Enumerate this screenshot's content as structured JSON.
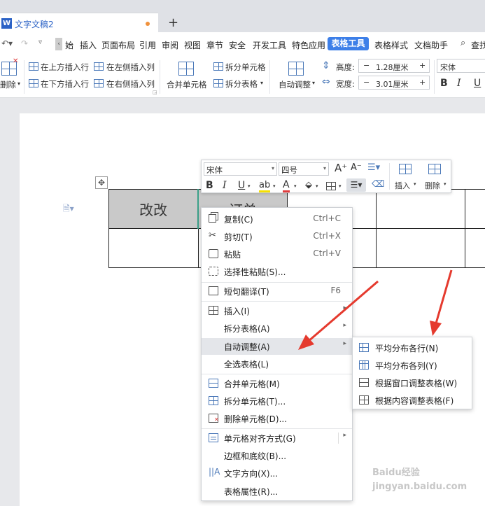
{
  "tab": {
    "title": "文字文稿2",
    "app_icon": "W",
    "new_tab": "+"
  },
  "menu": {
    "items": [
      "始",
      "插入",
      "页面布局",
      "引用",
      "审阅",
      "视图",
      "章节",
      "安全",
      "开发工具",
      "特色应用",
      "表格工具",
      "表格样式",
      "文档助手"
    ],
    "active": "表格工具",
    "search": "查找"
  },
  "ribbon": {
    "delete": "删除",
    "insert_above": "在上方插入行",
    "insert_below": "在下方插入行",
    "insert_left": "在左侧插入列",
    "insert_right": "在右侧插入列",
    "merge": "合并单元格",
    "split_cell": "拆分单元格",
    "split_table": "拆分表格",
    "auto_fit": "自动调整",
    "height_label": "高度:",
    "height_value": "1.28厘米",
    "width_label": "宽度:",
    "width_value": "3.01厘米",
    "font": "宋体",
    "minus": "−",
    "plus": "+"
  },
  "table": {
    "cell1": "改改",
    "cell2": "订单"
  },
  "mini_toolbar": {
    "font": "宋体",
    "size": "四号",
    "bold": "B",
    "italic": "I",
    "underline": "U",
    "font_color": "A",
    "grow": "A⁺",
    "shrink": "A⁻",
    "insert": "插入",
    "delete": "删除"
  },
  "context_menu": [
    {
      "label": "复制(C)",
      "shortcut": "Ctrl+C",
      "icon": "copy-icon"
    },
    {
      "label": "剪切(T)",
      "shortcut": "Ctrl+X",
      "icon": "cut-icon"
    },
    {
      "label": "粘贴",
      "shortcut": "Ctrl+V",
      "icon": "paste-icon"
    },
    {
      "label": "选择性粘贴(S)...",
      "shortcut": "",
      "icon": "paste-special-icon"
    },
    {
      "label": "短句翻译(T)",
      "shortcut": "F6",
      "icon": "translate-icon"
    },
    {
      "label": "插入(I)",
      "shortcut": "",
      "icon": "table-insert-icon"
    },
    {
      "label": "拆分表格(A)",
      "shortcut": "",
      "icon": ""
    },
    {
      "label": "自动调整(A)",
      "shortcut": "",
      "icon": ""
    },
    {
      "label": "全选表格(L)",
      "shortcut": "",
      "icon": ""
    },
    {
      "label": "合并单元格(M)",
      "shortcut": "",
      "icon": "merge-cells-icon"
    },
    {
      "label": "拆分单元格(T)...",
      "shortcut": "",
      "icon": "split-cells-icon"
    },
    {
      "label": "删除单元格(D)...",
      "shortcut": "",
      "icon": "delete-cells-icon"
    },
    {
      "label": "单元格对齐方式(G)",
      "shortcut": "",
      "icon": "cell-align-icon"
    },
    {
      "label": "边框和底纹(B)...",
      "shortcut": "",
      "icon": ""
    },
    {
      "label": "文字方向(X)...",
      "shortcut": "",
      "icon": "text-direction-icon"
    },
    {
      "label": "表格属性(R)...",
      "shortcut": "",
      "icon": ""
    }
  ],
  "submenu": [
    {
      "label": "平均分布各行(N)",
      "icon": "distribute-rows-icon"
    },
    {
      "label": "平均分布各列(Y)",
      "icon": "distribute-columns-icon"
    },
    {
      "label": "根据窗口调整表格(W)",
      "icon": "fit-window-icon"
    },
    {
      "label": "根据内容调整表格(F)",
      "icon": "fit-content-icon"
    }
  ],
  "colors": {
    "accent": "#3d7fe8",
    "arrow": "#e53a2e",
    "cell_fill": "#c9c9c9"
  },
  "watermark": "Baidu经验 jingyan.baidu.com"
}
